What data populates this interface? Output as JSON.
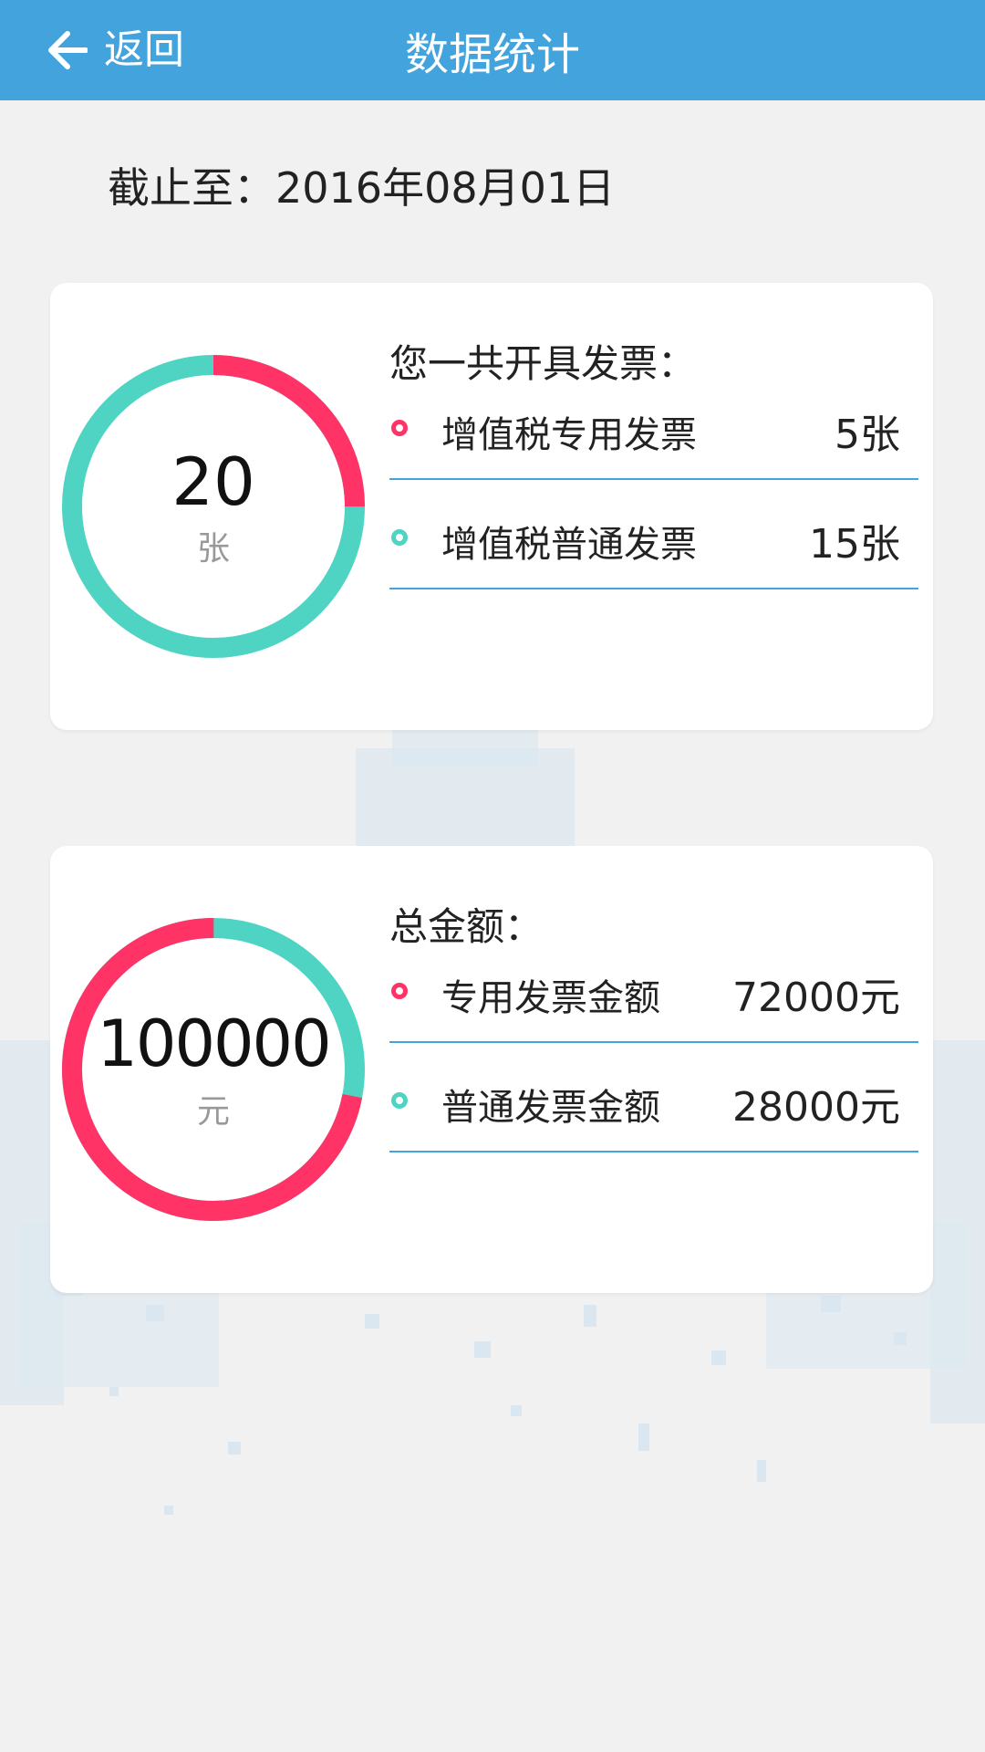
{
  "header": {
    "back_label": "返回",
    "title": "数据统计"
  },
  "as_of": "截止至：2016年08月01日",
  "invoice_card": {
    "total": "20",
    "unit": "张",
    "heading": "您一共开具发票：",
    "items": [
      {
        "name": "增值税专用发票",
        "value": "5张",
        "color": "#ff3366",
        "fraction": 0.25
      },
      {
        "name": "增值税普通发票",
        "value": "15张",
        "color": "#4fd4c4",
        "fraction": 0.75
      }
    ]
  },
  "amount_card": {
    "total": "100000",
    "unit": "元",
    "heading": "总金额：",
    "items": [
      {
        "name": "专用发票金额",
        "value": "72000元",
        "color": "#ff3366",
        "fraction": 0.72
      },
      {
        "name": "普通发票金额",
        "value": "28000元",
        "color": "#4fd4c4",
        "fraction": 0.28
      }
    ]
  },
  "colors": {
    "header": "#43a3dd",
    "accent_red": "#ff3366",
    "accent_teal": "#4fd4c4",
    "divider": "#43a3dd"
  }
}
